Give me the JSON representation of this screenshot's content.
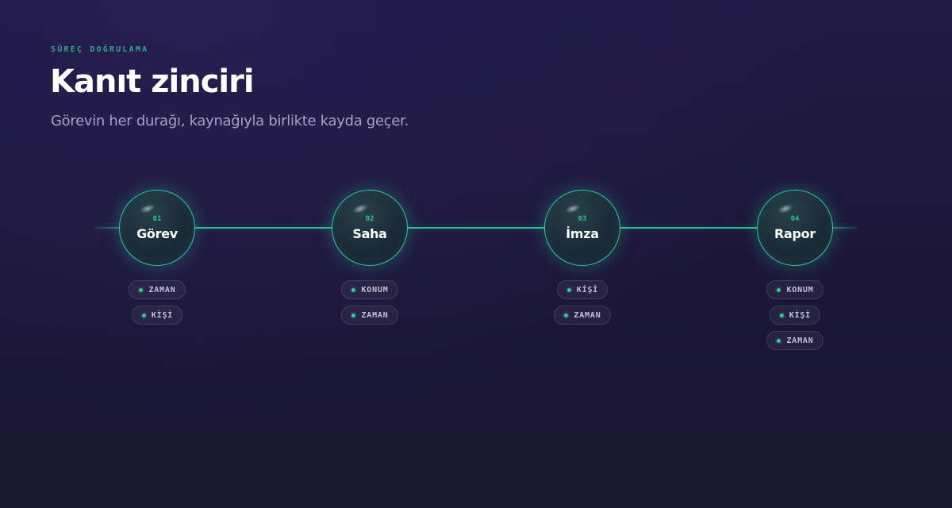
{
  "header": {
    "eyebrow": "SÜREÇ DOĞRULAMA",
    "title": "Kanıt zinciri",
    "subtitle": "Görevin her durağı, kaynağıyla birlikte kayda geçer."
  },
  "colors": {
    "accent": "#2fc79a",
    "background": "#1c1738"
  },
  "steps": [
    {
      "number": "01",
      "label": "Görev",
      "tags": [
        "ZAMAN",
        "KİŞİ"
      ]
    },
    {
      "number": "02",
      "label": "Saha",
      "tags": [
        "KONUM",
        "ZAMAN"
      ]
    },
    {
      "number": "03",
      "label": "İmza",
      "tags": [
        "KİŞİ",
        "ZAMAN"
      ]
    },
    {
      "number": "04",
      "label": "Rapor",
      "tags": [
        "KONUM",
        "KİŞİ",
        "ZAMAN"
      ]
    }
  ]
}
